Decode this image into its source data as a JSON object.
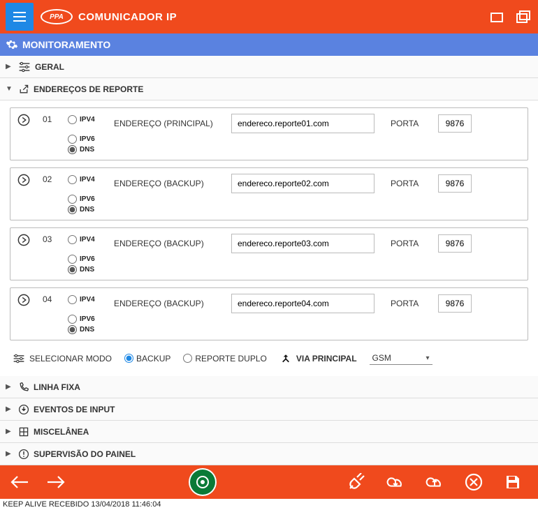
{
  "header": {
    "logo_text": "PPA",
    "title": "COMUNICADOR IP"
  },
  "subheader": {
    "label": "MONITORAMENTO"
  },
  "sections": {
    "geral": "GERAL",
    "enderecos": "ENDEREÇOS DE REPORTE",
    "linha_fixa": "LINHA FIXA",
    "eventos_input": "EVENTOS DE INPUT",
    "miscelanea": "MISCELÂNEA",
    "supervisao": "SUPERVISÃO DO PAINEL"
  },
  "addr_labels": {
    "ipv4": "IPV4",
    "ipv6": "IPV6",
    "dns": "DNS",
    "endereco_principal": "ENDEREÇO (PRINCIPAL)",
    "endereco_backup": "ENDEREÇO (BACKUP)",
    "porta": "PORTA"
  },
  "addresses": [
    {
      "num": "01",
      "type": "dns",
      "label_variant": "principal",
      "address": "endereco.reporte01.com",
      "port": "9876"
    },
    {
      "num": "02",
      "type": "dns",
      "label_variant": "backup",
      "address": "endereco.reporte02.com",
      "port": "9876"
    },
    {
      "num": "03",
      "type": "dns",
      "label_variant": "backup",
      "address": "endereco.reporte03.com",
      "port": "9876"
    },
    {
      "num": "04",
      "type": "dns",
      "label_variant": "backup",
      "address": "endereco.reporte04.com",
      "port": "9876"
    }
  ],
  "mode": {
    "selecionar_label": "SELECIONAR MODO",
    "backup_label": "BACKUP",
    "duplo_label": "REPORTE DUPLO",
    "selected": "backup",
    "via_label": "VIA PRINCIPAL",
    "via_value": "GSM"
  },
  "status_bar": "KEEP ALIVE RECEBIDO 13/04/2018 11:46:04"
}
